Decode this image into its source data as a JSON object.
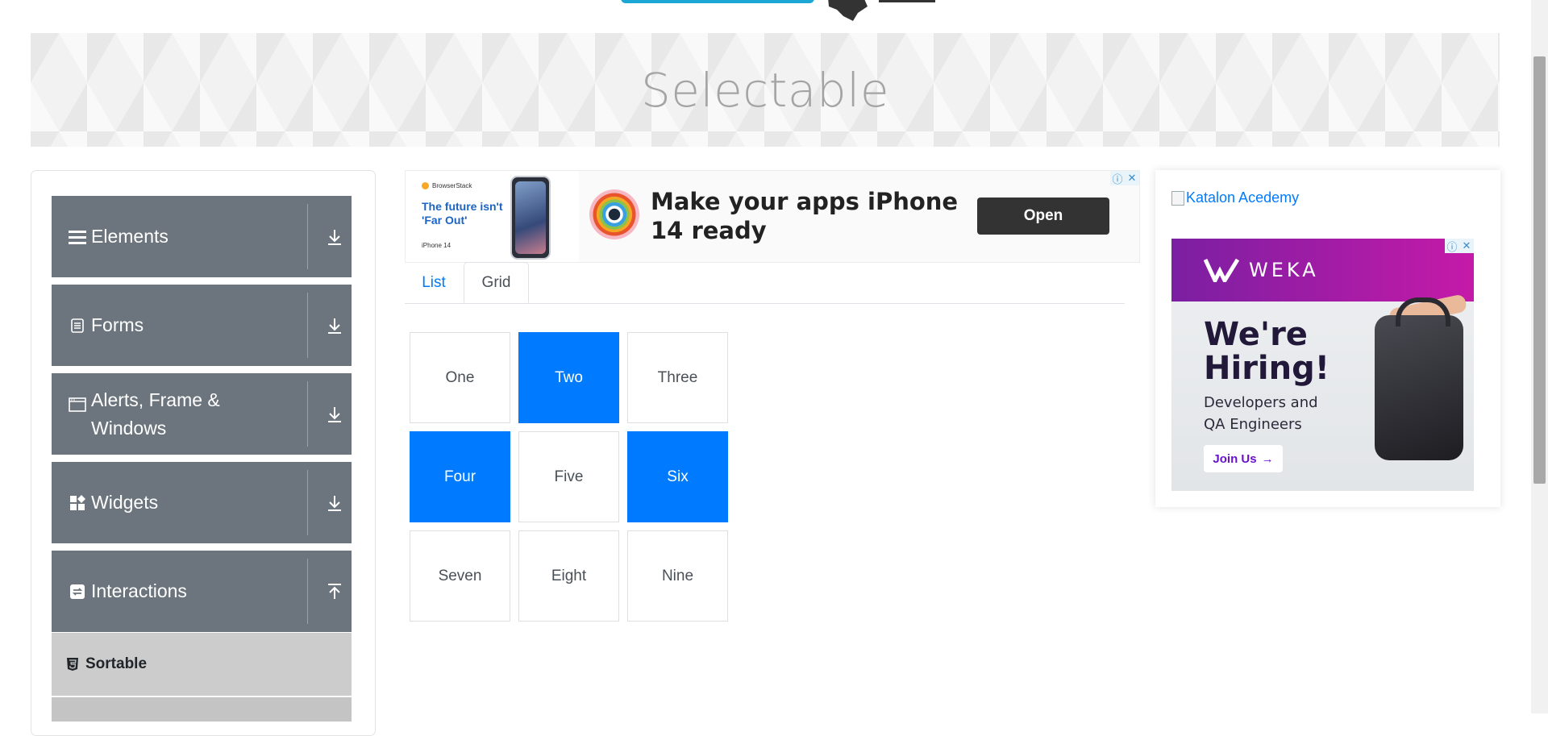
{
  "banner": {
    "title": "Selectable"
  },
  "sidebar": {
    "groups": [
      {
        "label": "Elements",
        "icon": "hamburger-icon",
        "arrow": "download-icon"
      },
      {
        "label": "Forms",
        "icon": "document-icon",
        "arrow": "download-icon"
      },
      {
        "label": "Alerts, Frame & Windows",
        "icon": "window-icon",
        "arrow": "download-icon"
      },
      {
        "label": "Widgets",
        "icon": "widgets-icon",
        "arrow": "download-icon"
      },
      {
        "label": "Interactions",
        "icon": "interactions-icon",
        "arrow": "upload-icon"
      }
    ],
    "items": [
      {
        "label": "Sortable",
        "icon": "html5-icon"
      }
    ]
  },
  "ad_top": {
    "brand": "BrowserStack",
    "tagline": "The future isn't 'Far Out'",
    "small": "iPhone 14",
    "headline": "Make your apps iPhone 14 ready",
    "cta": "Open"
  },
  "tabs": [
    {
      "label": "List",
      "active": false
    },
    {
      "label": "Grid",
      "active": true
    }
  ],
  "grid": {
    "cells": [
      {
        "label": "One",
        "selected": false
      },
      {
        "label": "Two",
        "selected": true
      },
      {
        "label": "Three",
        "selected": false
      },
      {
        "label": "Four",
        "selected": true
      },
      {
        "label": "Five",
        "selected": false
      },
      {
        "label": "Six",
        "selected": true
      },
      {
        "label": "Seven",
        "selected": false
      },
      {
        "label": "Eight",
        "selected": false
      },
      {
        "label": "Nine",
        "selected": false
      }
    ]
  },
  "ad_right": {
    "image_alt": "Katalon Acedemy",
    "weka": {
      "brand": "WEKA",
      "headline_line1": "We're",
      "headline_line2": "Hiring!",
      "sub_line1": "Developers and",
      "sub_line2": "QA Engineers",
      "cta": "Join Us"
    }
  },
  "colors": {
    "accent": "#007bff",
    "sidebar_group": "#6c757d",
    "sidebar_item": "#cccccc",
    "banner_title": "#a4a4a4"
  }
}
